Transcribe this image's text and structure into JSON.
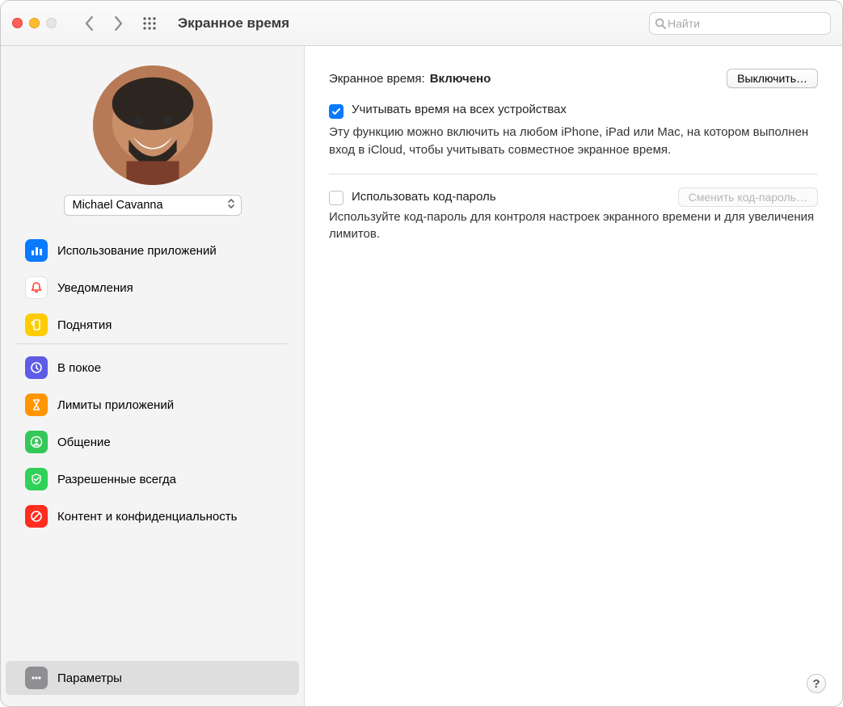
{
  "window": {
    "title": "Экранное время",
    "search_placeholder": "Найти"
  },
  "user": {
    "name": "Michael Cavanna"
  },
  "sidebar": {
    "group1": [
      {
        "label": "Использование приложений"
      },
      {
        "label": "Уведомления"
      },
      {
        "label": "Поднятия"
      }
    ],
    "group2": [
      {
        "label": "В покое"
      },
      {
        "label": "Лимиты приложений"
      },
      {
        "label": "Общение"
      },
      {
        "label": "Разрешенные всегда"
      },
      {
        "label": "Контент и конфиденциальность"
      }
    ],
    "options_label": "Параметры"
  },
  "main": {
    "status_label": "Экранное время:",
    "status_value": "Включено",
    "turn_off": "Выключить…",
    "share_devices_label": "Учитывать время на всех устройствах",
    "share_devices_desc": "Эту функцию можно включить на любом iPhone, iPad или Mac, на котором выполнен вход в iCloud, чтобы учитывать совместное экранное время.",
    "passcode_label": "Использовать код-пароль",
    "change_passcode": "Сменить код-пароль…",
    "passcode_desc": "Используйте код-пароль для контроля настроек экранного времени и для увеличения лимитов."
  }
}
